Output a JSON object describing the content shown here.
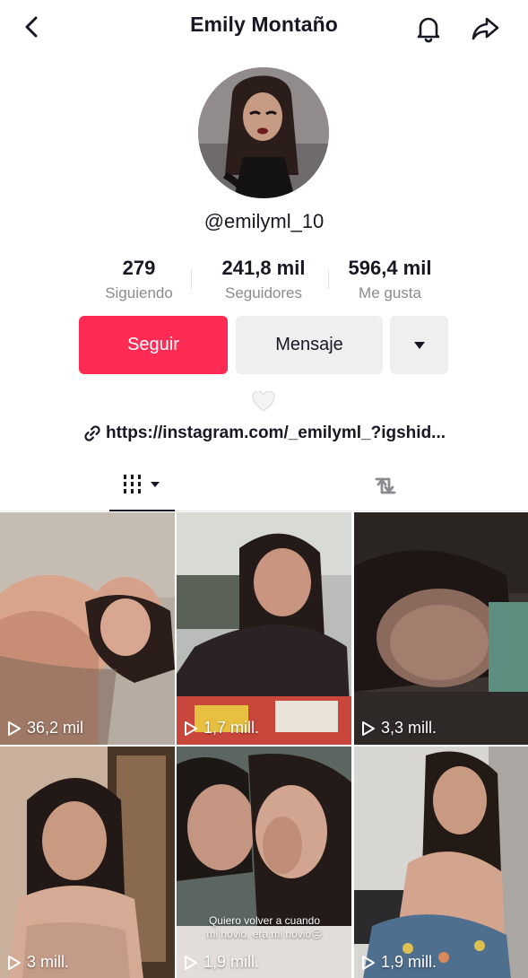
{
  "header": {
    "title": "Emily Montaño",
    "back_icon": "chevron-left-icon",
    "bell_icon": "bell-icon",
    "share_icon": "share-arrow-icon"
  },
  "profile": {
    "username": "@emilyml_10",
    "stats": [
      {
        "value": "279",
        "label": "Siguiendo"
      },
      {
        "value": "241,8 mil",
        "label": "Seguidores"
      },
      {
        "value": "596,4 mil",
        "label": "Me gusta"
      }
    ],
    "buttons": {
      "follow": "Seguir",
      "message": "Mensaje",
      "more_icon": "caret-down-icon"
    },
    "bio_icon": "white-heart-icon",
    "link": "https://instagram.com/_emilyml_?igshid..."
  },
  "tabs": {
    "videos_icon": "grid-bars-icon",
    "reposts_icon": "repost-icon"
  },
  "videos": [
    {
      "views": "36,2 mil",
      "caption": ""
    },
    {
      "views": "1,7 mill.",
      "caption": ""
    },
    {
      "views": "3,3 mill.",
      "caption": ""
    },
    {
      "views": "3 mill.",
      "caption": ""
    },
    {
      "views": "1,9 mill.",
      "caption": "Quiero volver a cuando mi novio, era mi novio😔"
    },
    {
      "views": "1,9 mill."
    }
  ],
  "colors": {
    "accent": "#fe2c55",
    "button_gray": "#efeff0",
    "text": "#161823",
    "muted": "#8a8b91"
  }
}
